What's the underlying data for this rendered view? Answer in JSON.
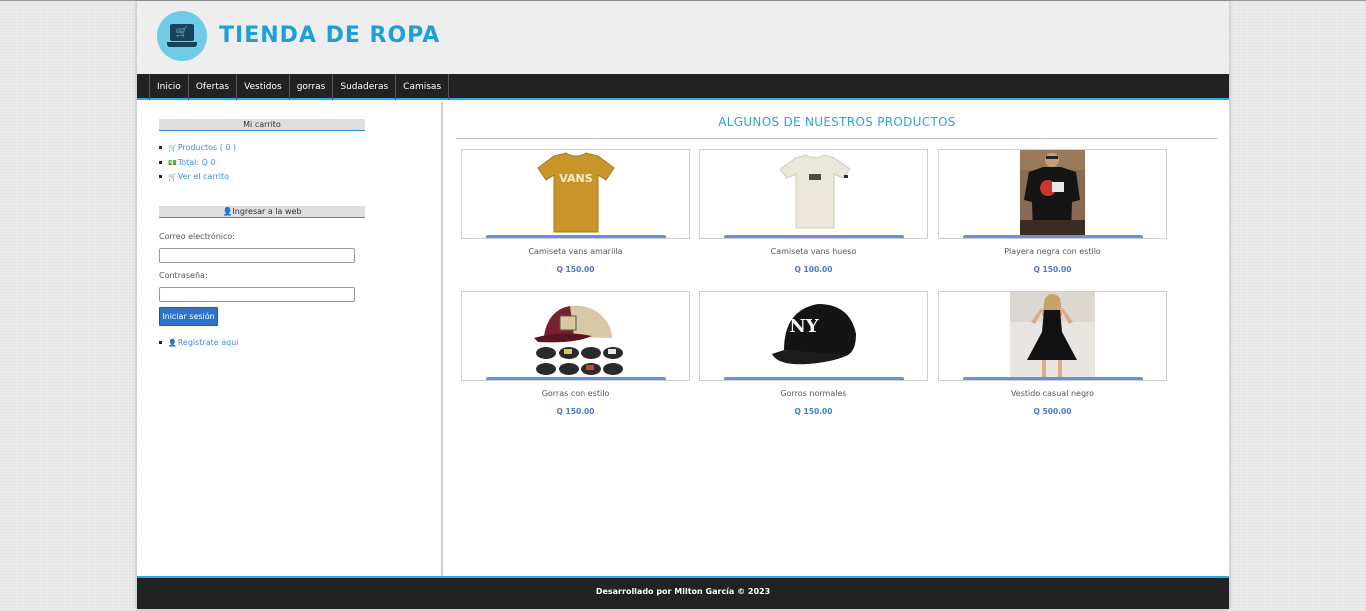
{
  "brand": {
    "title": "TIENDA DE ROPA",
    "logo_icon": "shopping-cart-laptop-icon"
  },
  "nav": {
    "items": [
      "Inicio",
      "Ofertas",
      "Vestidos",
      "gorras",
      "Sudaderas",
      "Camisas"
    ]
  },
  "cart": {
    "title": "Mi carrito",
    "products_label": "Productos ( 0 )",
    "total_label": "Total: Q 0",
    "view_label": "Ver el carrito"
  },
  "login": {
    "title": "Ingresar a la web",
    "email_label": "Correo electrónico:",
    "email_value": "",
    "password_label": "Contraseña:",
    "password_value": "",
    "submit_label": "Iniciar sesión",
    "register_label": "Registrate aqui"
  },
  "main": {
    "title": "ALGUNOS DE NUESTROS PRODUCTOS"
  },
  "products": [
    {
      "name": "Camiseta vans amarilla",
      "price": "Q 150.00"
    },
    {
      "name": "Camiseta vans hueso",
      "price": "Q 100.00"
    },
    {
      "name": "Playera negra con estilo",
      "price": "Q 150.00"
    },
    {
      "name": "Gorras con estilo",
      "price": "Q 150.00"
    },
    {
      "name": "Gorros normales",
      "price": "Q 150.00"
    },
    {
      "name": "Vestido casual negro",
      "price": "Q 500.00"
    }
  ],
  "footer": {
    "text": "Desarrollado por Milton García © 2023"
  },
  "colors": {
    "accent": "#2ea9df",
    "dark": "#222222",
    "link": "#3c8fd6",
    "button": "#2f73c9"
  }
}
